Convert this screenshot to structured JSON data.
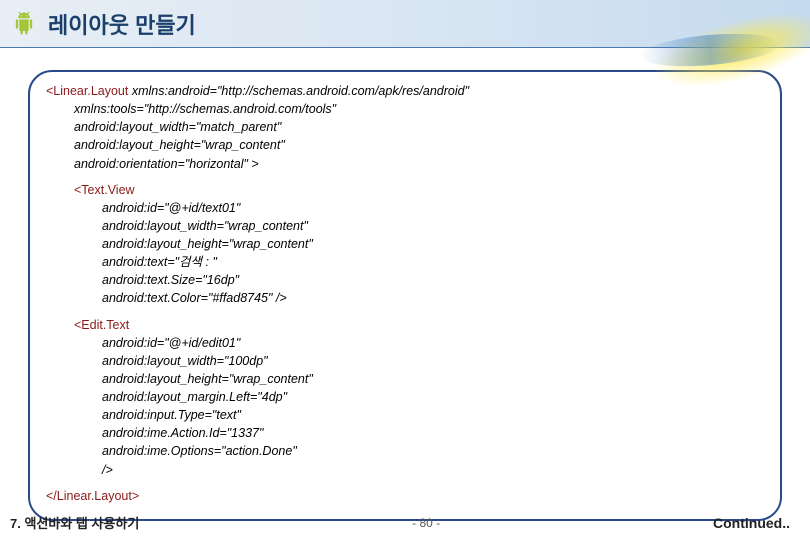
{
  "header": {
    "title": "레이아웃 만들기"
  },
  "code": {
    "linearLayout": {
      "open": "<Linear.Layout",
      "xmlnsAndroid": "xmlns:android=\"http://schemas.android.com/apk/res/android\"",
      "xmlnsTools": "xmlns:tools=\"http://schemas.android.com/tools\"",
      "width": "android:layout_width=\"match_parent\"",
      "height": "android:layout_height=\"wrap_content\"",
      "orientation": "android:orientation=\"horizontal\" >",
      "close": "</Linear.Layout>"
    },
    "textView": {
      "open": "<Text.View",
      "id": "android:id=\"@+id/text01\"",
      "width": "android:layout_width=\"wrap_content\"",
      "height": "android:layout_height=\"wrap_content\"",
      "text": "android:text=\"검색 : \"",
      "textSize": "android:text.Size=\"16dp\"",
      "textColor": "android:text.Color=\"#ffad8745\" />"
    },
    "editText": {
      "open": "<Edit.Text",
      "id": "android:id=\"@+id/edit01\"",
      "width": "android:layout_width=\"100dp\"",
      "height": "android:layout_height=\"wrap_content\"",
      "marginLeft": "android:layout_margin.Left=\"4dp\"",
      "inputType": "android:input.Type=\"text\"",
      "imeActionId": "android:ime.Action.Id=\"1337\"",
      "imeOptions": "android:ime.Options=\"action.Done\"",
      "close": "/>"
    }
  },
  "footer": {
    "left": "7. 액션바와 탭 사용하기",
    "center": "- 80 -",
    "right": "Continued.."
  }
}
